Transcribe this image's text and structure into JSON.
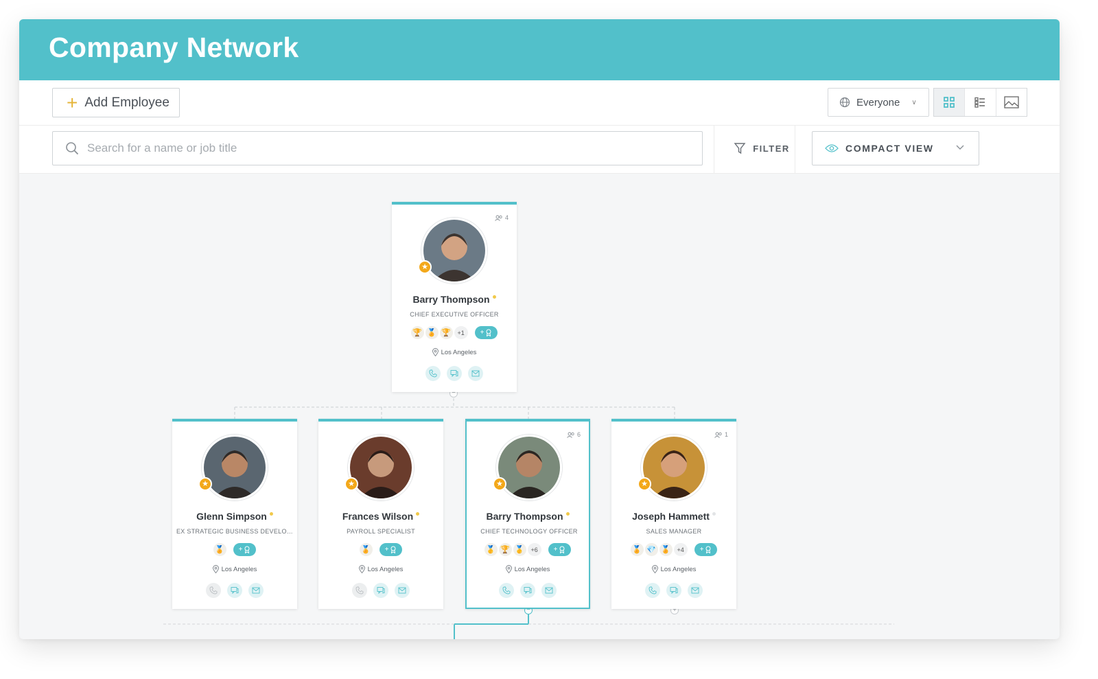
{
  "app": {
    "title": "Company Network"
  },
  "toolbar": {
    "add_label": "Add Employee",
    "audience_label": "Everyone",
    "views": [
      "grid-view",
      "list-view",
      "image-view"
    ]
  },
  "search": {
    "placeholder": "Search for a name or job title",
    "value": ""
  },
  "filter": {
    "label": "FILTER"
  },
  "view_mode": {
    "label": "COMPACT VIEW"
  },
  "colors": {
    "accent": "#52c0ca",
    "star": "#f3a81a"
  },
  "employees": [
    {
      "name": "Barry Thompson",
      "title": "CHIEF EXECUTIVE OFFICER",
      "reports": "4",
      "badges": [
        "🏆",
        "🏅",
        "🏆"
      ],
      "more": "+1",
      "location": "Los Angeles",
      "phone_active": true
    },
    {
      "name": "Glenn Simpson",
      "title": "EX STRATEGIC BUSINESS DEVELOP...",
      "reports": "",
      "badges": [
        "🏅"
      ],
      "more": "",
      "location": "Los Angeles",
      "phone_active": false
    },
    {
      "name": "Frances Wilson",
      "title": "PAYROLL SPECIALIST",
      "reports": "",
      "badges": [
        "🏅"
      ],
      "more": "",
      "location": "Los Angeles",
      "phone_active": false
    },
    {
      "name": "Barry Thompson",
      "title": "CHIEF TECHNOLOGY OFFICER",
      "reports": "6",
      "badges": [
        "🥇",
        "🏆",
        "🥇"
      ],
      "more": "+6",
      "location": "Los Angeles",
      "phone_active": true
    },
    {
      "name": "Joseph Hammett",
      "title": "SALES MANAGER",
      "reports": "1",
      "badges": [
        "🏅",
        "💎",
        "🏅"
      ],
      "more": "+4",
      "location": "Los Angeles",
      "phone_active": true
    }
  ]
}
